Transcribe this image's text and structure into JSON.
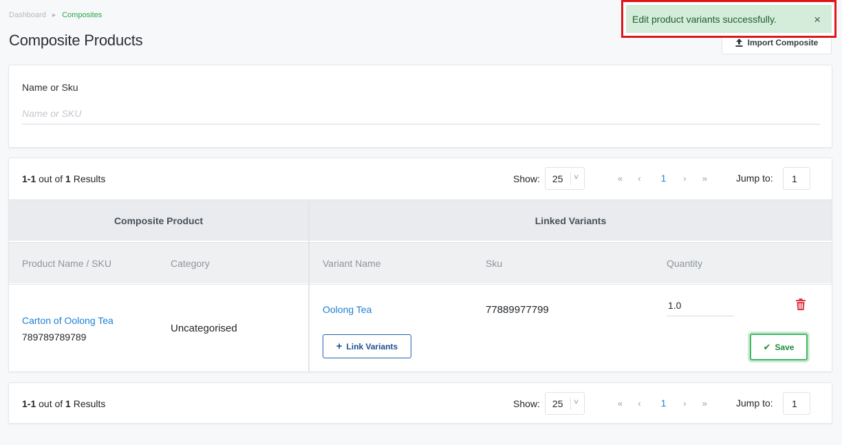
{
  "breadcrumb": {
    "home": "Dashboard",
    "current": "Composites"
  },
  "page": {
    "title": "Composite Products",
    "import_label": "Import Composite"
  },
  "toast": {
    "message": "Edit product variants successfully.",
    "close": "×"
  },
  "filter": {
    "label": "Name or Sku",
    "placeholder": "Name or SKU"
  },
  "pagination": {
    "range": "1-1",
    "out_of": "out of",
    "total": "1",
    "results": "Results",
    "show_label": "Show:",
    "page_size": "25",
    "first": "«",
    "prev": "‹",
    "current_page": "1",
    "next": "›",
    "last": "»",
    "jump_label": "Jump to:",
    "jump_value": "1"
  },
  "table": {
    "group_headers": [
      "Composite Product",
      "Linked Variants"
    ],
    "columns": [
      "Product Name / SKU",
      "Category",
      "Variant Name",
      "Sku",
      "Quantity"
    ],
    "rows": [
      {
        "product_name": "Carton of Oolong Tea",
        "product_sku": "789789789789",
        "category": "Uncategorised",
        "variant_name": "Oolong Tea",
        "variant_sku": "77889977799",
        "quantity": "1.0",
        "link_variants_label": "Link Variants",
        "save_label": "Save"
      }
    ]
  },
  "colors": {
    "link": "#1a7fd4",
    "toast_bg": "#d4ecda",
    "toast_highlight": "#e0141b",
    "save": "#1f8a3a",
    "delete": "#dc3545"
  }
}
